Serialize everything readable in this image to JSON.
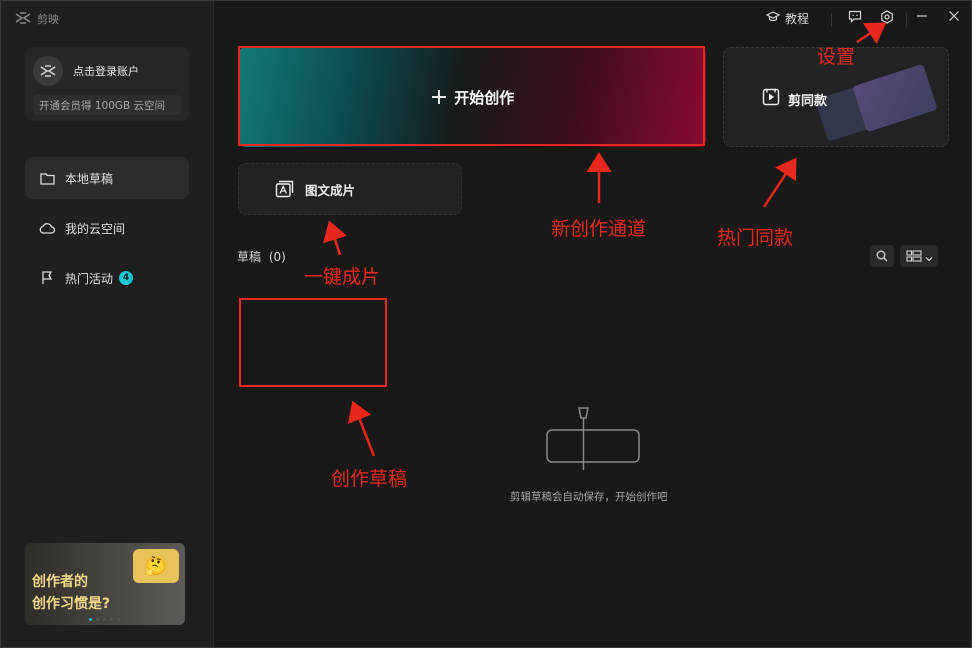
{
  "app": {
    "name": "剪映",
    "logo_icon": "capcut-logo-icon"
  },
  "topbar": {
    "tutorial_label": "教程",
    "tutorial_icon": "graduation-cap-icon",
    "feedback_icon": "message-icon",
    "settings_icon": "gear-icon",
    "minimize_icon": "minimize-icon",
    "close_icon": "close-icon"
  },
  "account": {
    "login_label": "点击登录账户",
    "vip_promo": "开通会员得 100GB 云空间"
  },
  "sidebar": {
    "items": [
      {
        "label": "本地草稿",
        "icon": "folder-icon",
        "active": true
      },
      {
        "label": "我的云空间",
        "icon": "cloud-icon",
        "active": false
      },
      {
        "label": "热门活动",
        "icon": "flag-icon",
        "active": false,
        "badge": "4"
      }
    ]
  },
  "banner": {
    "line1": "创作者的",
    "line2": "创作习惯是?"
  },
  "main": {
    "start_label": "开始创作",
    "template_label": "剪同款",
    "text_to_video_label": "图文成片",
    "drafts_title": "草稿",
    "drafts_count": "(0)",
    "empty_text": "剪辑草稿会自动保存，开始创作吧"
  },
  "annotations": {
    "settings": "设置",
    "new_creation": "新创作通道",
    "hot_template": "热门同款",
    "one_click": "一键成片",
    "draft": "创作草稿"
  },
  "colors": {
    "annotation": "#e8281e",
    "accent": "#17c4d1"
  }
}
